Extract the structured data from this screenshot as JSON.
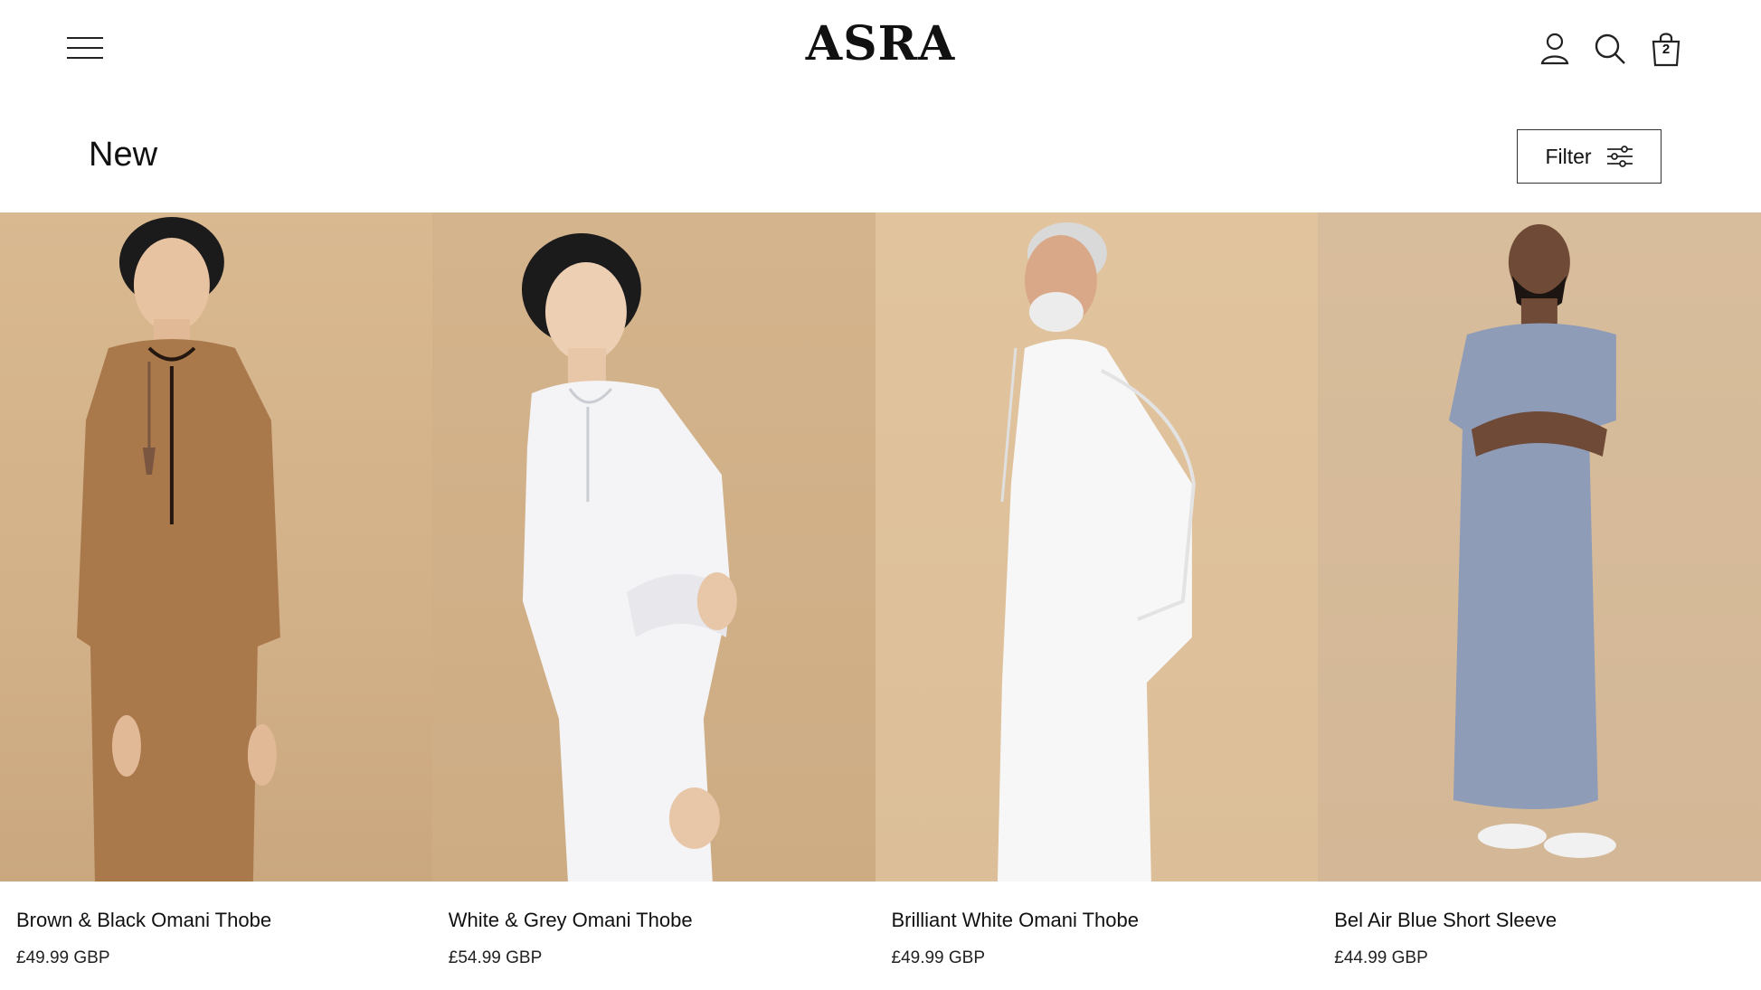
{
  "header": {
    "brand": "ASRA",
    "cart_count": "2"
  },
  "collection": {
    "title": "New",
    "filter_label": "Filter"
  },
  "products": [
    {
      "name": "Brown & Black Omani Thobe",
      "price": "£49.99 GBP",
      "color": "#a9794b"
    },
    {
      "name": "White & Grey Omani Thobe",
      "price": "£54.99 GBP",
      "color": "#f4f4f6"
    },
    {
      "name": "Brilliant White Omani Thobe",
      "price": "£49.99 GBP",
      "color": "#f7f7f7"
    },
    {
      "name": "Bel Air Blue Short Sleeve",
      "price": "£44.99 GBP",
      "color": "#8e9cb8"
    }
  ],
  "colors": {
    "background": "#ffffff",
    "text": "#111111",
    "photo_backdrop": "#d6b68e"
  }
}
